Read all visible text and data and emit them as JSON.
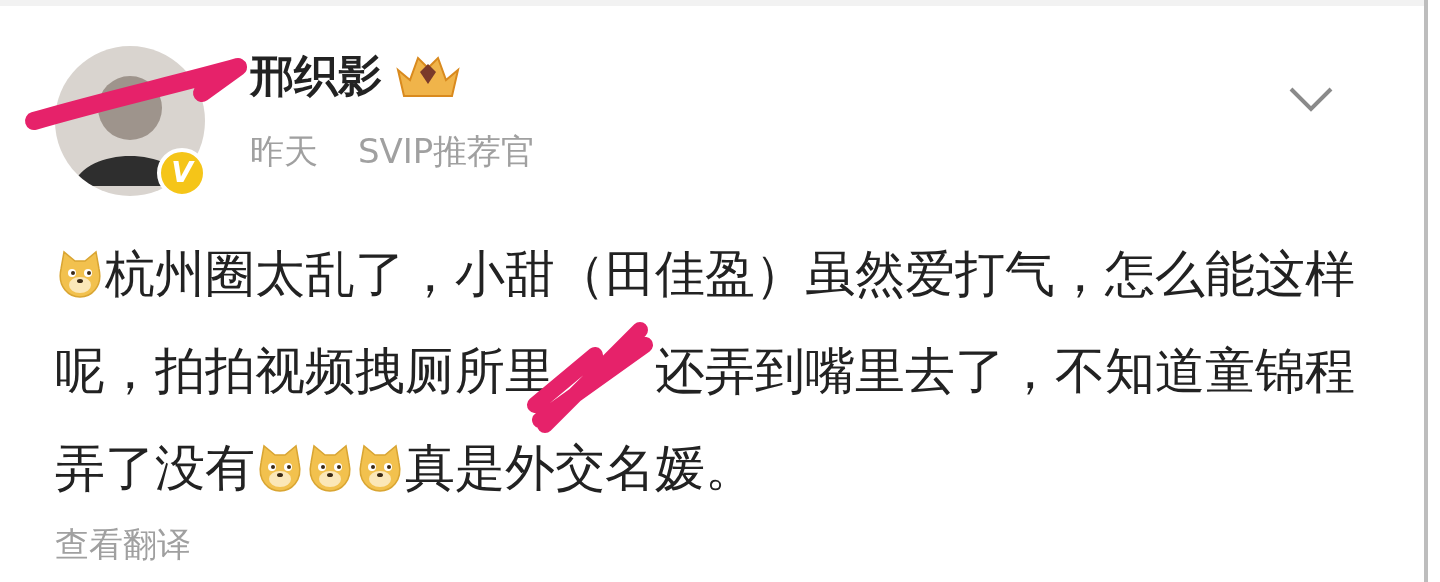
{
  "author": {
    "name": "邢织影",
    "verified_mark": "V"
  },
  "meta": {
    "time": "昨天",
    "source": "SVIP推荐官"
  },
  "post": {
    "segments": [
      {
        "kind": "emoji"
      },
      {
        "kind": "text",
        "text": "杭州圈太乱了，小甜（田佳盈）虽然爱打气，怎么能这样呢，拍拍视频拽厕所里"
      },
      {
        "kind": "scribble"
      },
      {
        "kind": "text",
        "text": "还弄到嘴里去了，不知道童锦程弄了没有"
      },
      {
        "kind": "emoji"
      },
      {
        "kind": "emoji"
      },
      {
        "kind": "emoji"
      },
      {
        "kind": "text",
        "text": "真是外交名媛。"
      }
    ]
  },
  "translate_link": "查看翻译"
}
